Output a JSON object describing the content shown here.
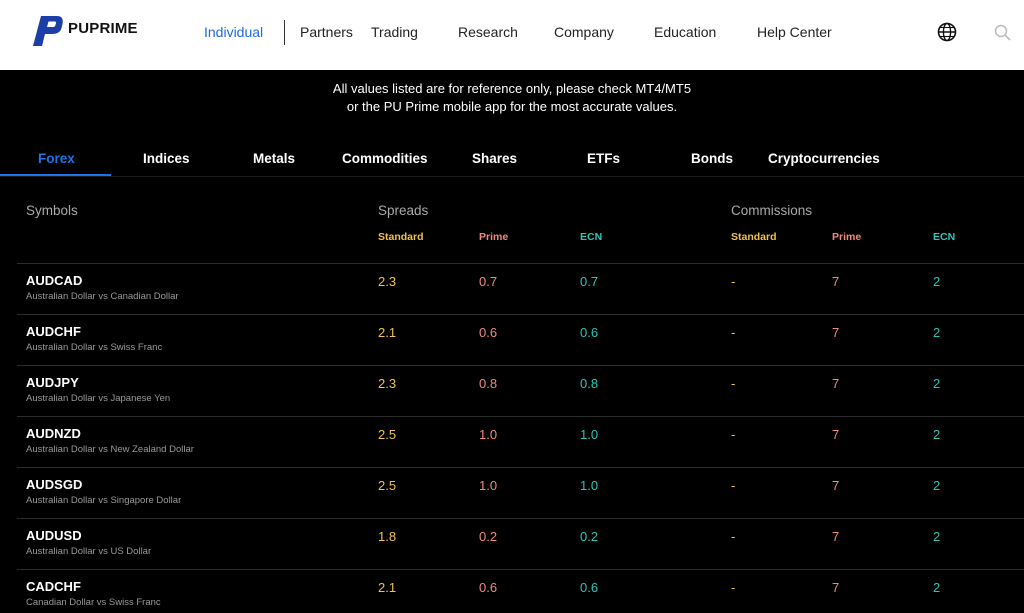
{
  "header": {
    "brand": "PUPRIME",
    "nav": [
      "Individual",
      "Partners",
      "Trading",
      "Research",
      "Company",
      "Education",
      "Help Center"
    ]
  },
  "notice": {
    "line1": "All values listed are for reference only, please check MT4/MT5",
    "line2": "or the PU Prime mobile app for the most accurate values."
  },
  "tabs": [
    "Forex",
    "Indices",
    "Metals",
    "Commodities",
    "Shares",
    "ETFs",
    "Bonds",
    "Cryptocurrencies"
  ],
  "table": {
    "symbols_label": "Symbols",
    "spreads_label": "Spreads",
    "commissions_label": "Commissions",
    "sub_headers": [
      "Standard",
      "Prime",
      "ECN",
      "Standard",
      "Prime",
      "ECN"
    ],
    "rows": [
      {
        "symbol": "AUDCAD",
        "desc": "Australian Dollar vs Canadian Dollar",
        "values": [
          "2.3",
          "0.7",
          "0.7",
          "-",
          "7",
          "2"
        ]
      },
      {
        "symbol": "AUDCHF",
        "desc": "Australian Dollar vs Swiss Franc",
        "values": [
          "2.1",
          "0.6",
          "0.6",
          "-",
          "7",
          "2"
        ]
      },
      {
        "symbol": "AUDJPY",
        "desc": "Australian Dollar vs Japanese Yen",
        "values": [
          "2.3",
          "0.8",
          "0.8",
          "-",
          "7",
          "2"
        ]
      },
      {
        "symbol": "AUDNZD",
        "desc": "Australian Dollar vs New Zealand Dollar",
        "values": [
          "2.5",
          "1.0",
          "1.0",
          "-",
          "7",
          "2"
        ]
      },
      {
        "symbol": "AUDSGD",
        "desc": "Australian Dollar vs Singapore Dollar",
        "values": [
          "2.5",
          "1.0",
          "1.0",
          "-",
          "7",
          "2"
        ]
      },
      {
        "symbol": "AUDUSD",
        "desc": "Australian Dollar vs US Dollar",
        "values": [
          "1.8",
          "0.2",
          "0.2",
          "-",
          "7",
          "2"
        ]
      },
      {
        "symbol": "CADCHF",
        "desc": "Canadian Dollar vs Swiss Franc",
        "values": [
          "2.1",
          "0.6",
          "0.6",
          "-",
          "7",
          "2"
        ]
      }
    ]
  },
  "colors": {
    "accent": "#1e73e8",
    "standard": "#f2c14e",
    "prime": "#f08a7a",
    "ecn": "#2ec4b6"
  },
  "icons": {
    "logo": "puprime-logo-icon",
    "language": "globe-icon",
    "search": "search-icon"
  }
}
